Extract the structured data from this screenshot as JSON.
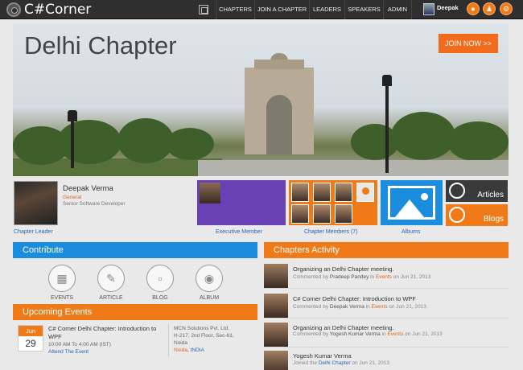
{
  "header": {
    "logo_text": "C#Corner",
    "nav": [
      "CHAPTERS",
      "JOIN A CHAPTER",
      "LEADERS",
      "SPEAKERS",
      "ADMIN"
    ],
    "user_name": "Deepak"
  },
  "hero": {
    "title": "Delhi Chapter",
    "join_button": "JOIN NOW >>"
  },
  "leader": {
    "name": "Deepak Verma",
    "role": "General",
    "title": "Senior Software Developer",
    "caption": "Chapter Leader"
  },
  "tiles": {
    "executive_caption": "Executive Member",
    "members_caption": "Chapter Members (7)",
    "albums_caption": "Albums",
    "articles_label": "Articles",
    "blogs_label": "Blogs"
  },
  "contribute": {
    "heading": "Contribute",
    "items": [
      "EVENTS",
      "ARTICLE",
      "BLOG",
      "ALBUM"
    ]
  },
  "events": {
    "heading": "Upcoming Events",
    "month": "Jun",
    "day": "29",
    "title": "C# Corner Delhi Chapter: Introduction to WPF",
    "time": "10:00 AM To 4:00 AM (IST)",
    "attend": "Attend The Event",
    "venue_line1": "MCN Solutions Pvt. Ltd.",
    "venue_line2": "H-217, 2nd Floor, Sec-63,",
    "venue_line3": "Noida",
    "city": "Noida",
    "country": "INDIA"
  },
  "activity": {
    "heading": "Chapters Activity",
    "items": [
      {
        "title": "Organizing an Delhi Chapter meeting.",
        "verb": "Commented by",
        "who": "Pradeep Pandey",
        "in_text": "in",
        "link": "Events",
        "on_text": "on Jun 21, 2013"
      },
      {
        "title": "C# Corner Delhi Chapter: Introduction to WPF",
        "verb": "Commented by",
        "who": "Deepak Verma",
        "in_text": "in",
        "link": "Events",
        "on_text": "on Jun 21, 2013"
      },
      {
        "title": "Organizing an Delhi Chapter meeting.",
        "verb": "Commented by",
        "who": "Yogesh Kumar Verma",
        "in_text": "in",
        "link": "Events",
        "on_text": "on Jun 21, 2013"
      },
      {
        "title": "Yogesh Kumar Verma",
        "verb": "Joined the",
        "who": "",
        "in_text": "",
        "link": "Delhi Chapter",
        "on_text": "on Jun 21, 2013"
      }
    ]
  }
}
